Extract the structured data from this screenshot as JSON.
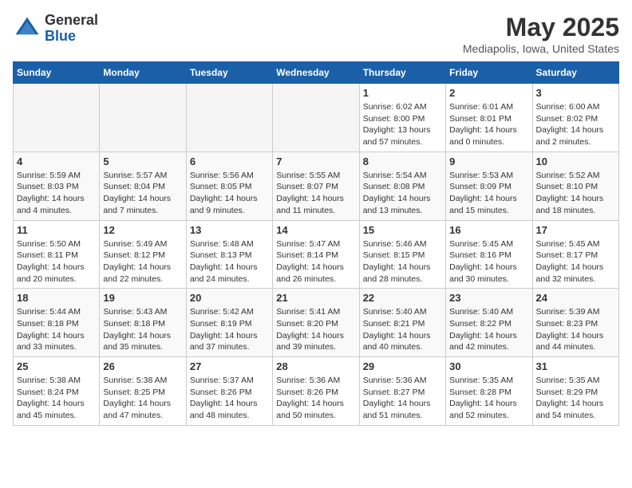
{
  "header": {
    "logo_general": "General",
    "logo_blue": "Blue",
    "month_title": "May 2025",
    "location": "Mediapolis, Iowa, United States"
  },
  "weekdays": [
    "Sunday",
    "Monday",
    "Tuesday",
    "Wednesday",
    "Thursday",
    "Friday",
    "Saturday"
  ],
  "weeks": [
    [
      {
        "day": "",
        "empty": true
      },
      {
        "day": "",
        "empty": true
      },
      {
        "day": "",
        "empty": true
      },
      {
        "day": "",
        "empty": true
      },
      {
        "day": "1",
        "sunrise": "6:02 AM",
        "sunset": "8:00 PM",
        "daylight": "13 hours and 57 minutes."
      },
      {
        "day": "2",
        "sunrise": "6:01 AM",
        "sunset": "8:01 PM",
        "daylight": "14 hours and 0 minutes."
      },
      {
        "day": "3",
        "sunrise": "6:00 AM",
        "sunset": "8:02 PM",
        "daylight": "14 hours and 2 minutes."
      }
    ],
    [
      {
        "day": "4",
        "sunrise": "5:59 AM",
        "sunset": "8:03 PM",
        "daylight": "14 hours and 4 minutes."
      },
      {
        "day": "5",
        "sunrise": "5:57 AM",
        "sunset": "8:04 PM",
        "daylight": "14 hours and 7 minutes."
      },
      {
        "day": "6",
        "sunrise": "5:56 AM",
        "sunset": "8:05 PM",
        "daylight": "14 hours and 9 minutes."
      },
      {
        "day": "7",
        "sunrise": "5:55 AM",
        "sunset": "8:07 PM",
        "daylight": "14 hours and 11 minutes."
      },
      {
        "day": "8",
        "sunrise": "5:54 AM",
        "sunset": "8:08 PM",
        "daylight": "14 hours and 13 minutes."
      },
      {
        "day": "9",
        "sunrise": "5:53 AM",
        "sunset": "8:09 PM",
        "daylight": "14 hours and 15 minutes."
      },
      {
        "day": "10",
        "sunrise": "5:52 AM",
        "sunset": "8:10 PM",
        "daylight": "14 hours and 18 minutes."
      }
    ],
    [
      {
        "day": "11",
        "sunrise": "5:50 AM",
        "sunset": "8:11 PM",
        "daylight": "14 hours and 20 minutes."
      },
      {
        "day": "12",
        "sunrise": "5:49 AM",
        "sunset": "8:12 PM",
        "daylight": "14 hours and 22 minutes."
      },
      {
        "day": "13",
        "sunrise": "5:48 AM",
        "sunset": "8:13 PM",
        "daylight": "14 hours and 24 minutes."
      },
      {
        "day": "14",
        "sunrise": "5:47 AM",
        "sunset": "8:14 PM",
        "daylight": "14 hours and 26 minutes."
      },
      {
        "day": "15",
        "sunrise": "5:46 AM",
        "sunset": "8:15 PM",
        "daylight": "14 hours and 28 minutes."
      },
      {
        "day": "16",
        "sunrise": "5:45 AM",
        "sunset": "8:16 PM",
        "daylight": "14 hours and 30 minutes."
      },
      {
        "day": "17",
        "sunrise": "5:45 AM",
        "sunset": "8:17 PM",
        "daylight": "14 hours and 32 minutes."
      }
    ],
    [
      {
        "day": "18",
        "sunrise": "5:44 AM",
        "sunset": "8:18 PM",
        "daylight": "14 hours and 33 minutes."
      },
      {
        "day": "19",
        "sunrise": "5:43 AM",
        "sunset": "8:18 PM",
        "daylight": "14 hours and 35 minutes."
      },
      {
        "day": "20",
        "sunrise": "5:42 AM",
        "sunset": "8:19 PM",
        "daylight": "14 hours and 37 minutes."
      },
      {
        "day": "21",
        "sunrise": "5:41 AM",
        "sunset": "8:20 PM",
        "daylight": "14 hours and 39 minutes."
      },
      {
        "day": "22",
        "sunrise": "5:40 AM",
        "sunset": "8:21 PM",
        "daylight": "14 hours and 40 minutes."
      },
      {
        "day": "23",
        "sunrise": "5:40 AM",
        "sunset": "8:22 PM",
        "daylight": "14 hours and 42 minutes."
      },
      {
        "day": "24",
        "sunrise": "5:39 AM",
        "sunset": "8:23 PM",
        "daylight": "14 hours and 44 minutes."
      }
    ],
    [
      {
        "day": "25",
        "sunrise": "5:38 AM",
        "sunset": "8:24 PM",
        "daylight": "14 hours and 45 minutes."
      },
      {
        "day": "26",
        "sunrise": "5:38 AM",
        "sunset": "8:25 PM",
        "daylight": "14 hours and 47 minutes."
      },
      {
        "day": "27",
        "sunrise": "5:37 AM",
        "sunset": "8:26 PM",
        "daylight": "14 hours and 48 minutes."
      },
      {
        "day": "28",
        "sunrise": "5:36 AM",
        "sunset": "8:26 PM",
        "daylight": "14 hours and 50 minutes."
      },
      {
        "day": "29",
        "sunrise": "5:36 AM",
        "sunset": "8:27 PM",
        "daylight": "14 hours and 51 minutes."
      },
      {
        "day": "30",
        "sunrise": "5:35 AM",
        "sunset": "8:28 PM",
        "daylight": "14 hours and 52 minutes."
      },
      {
        "day": "31",
        "sunrise": "5:35 AM",
        "sunset": "8:29 PM",
        "daylight": "14 hours and 54 minutes."
      }
    ]
  ]
}
